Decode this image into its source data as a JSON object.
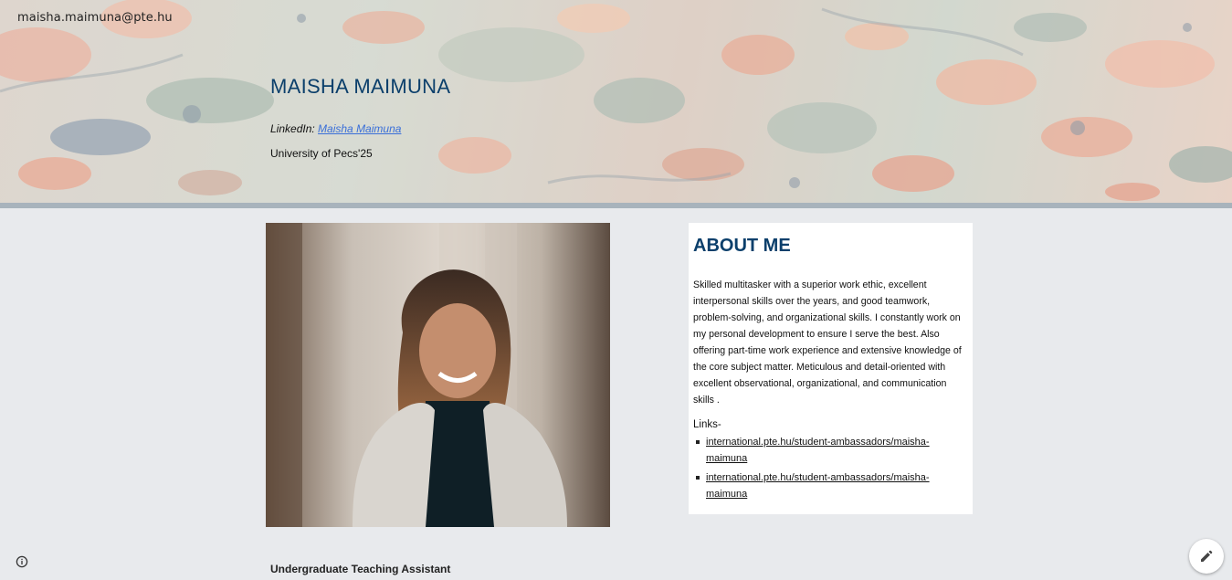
{
  "site": {
    "email": "maisha.maimuna@pte.hu"
  },
  "hero": {
    "name": "MAISHA MAIMUNA",
    "linkedin_label": "LinkedIn:",
    "linkedin_link_text": "Maisha Maimuna",
    "university": "University of Pecs'25"
  },
  "about": {
    "title": "ABOUT ME",
    "body": "Skilled multitasker with a superior work ethic, excellent interpersonal skills over the years, and good teamwork, problem-solving, and organizational skills. I constantly work on my personal development to ensure I serve the best. Also offering part-time work experience and extensive knowledge of the core subject matter. Meticulous and detail-oriented with excellent observational, organizational, and communication skills .",
    "links_label": "Links-",
    "links": [
      "international.pte.hu/student-ambassadors/maisha-maimuna",
      "international.pte.hu/student-ambassadors/maisha-maimuna"
    ]
  },
  "section": {
    "heading": "Undergraduate Teaching Assistant"
  },
  "icons": {
    "info": "info-icon",
    "edit": "pencil-icon"
  },
  "colors": {
    "title_blue": "#0b3f6b",
    "link_blue": "#3a6fd8",
    "page_bg": "#e8eaed"
  }
}
